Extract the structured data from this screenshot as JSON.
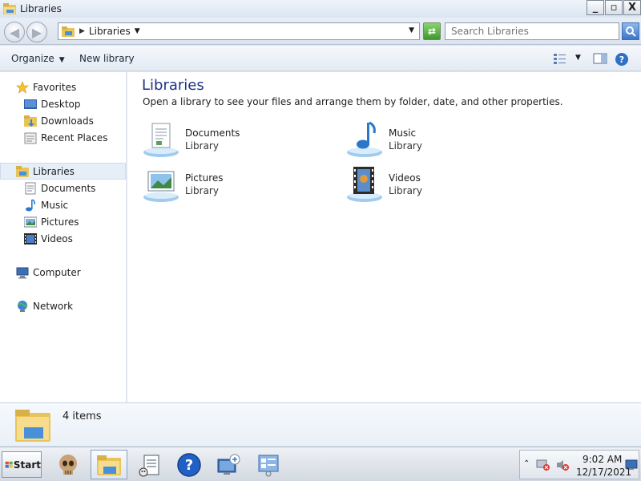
{
  "window": {
    "title": "Libraries",
    "buttons": {
      "minimize": "_",
      "maximize": "▫",
      "close": "X"
    }
  },
  "address_bar": {
    "separator": "▶",
    "crumb": "Libraries",
    "crumb_dropdown": "▼",
    "dropdown": "▼"
  },
  "search": {
    "placeholder": "Search Libraries"
  },
  "command_bar": {
    "organize": "Organize",
    "organize_dropdown": "▼",
    "new_library": "New library"
  },
  "nav_pane": {
    "favorites": {
      "label": "Favorites",
      "icon": "star-icon",
      "items": [
        {
          "label": "Desktop",
          "icon": "desktop-icon"
        },
        {
          "label": "Downloads",
          "icon": "downloads-folder-icon"
        },
        {
          "label": "Recent Places",
          "icon": "recent-places-icon"
        }
      ]
    },
    "libraries": {
      "label": "Libraries",
      "icon": "libraries-icon",
      "items": [
        {
          "label": "Documents",
          "icon": "document-icon"
        },
        {
          "label": "Music",
          "icon": "music-note-icon"
        },
        {
          "label": "Pictures",
          "icon": "picture-icon"
        },
        {
          "label": "Videos",
          "icon": "video-icon"
        }
      ]
    },
    "computer": {
      "label": "Computer",
      "icon": "computer-icon"
    },
    "network": {
      "label": "Network",
      "icon": "network-icon"
    }
  },
  "content": {
    "heading": "Libraries",
    "subtitle": "Open a library to see your files and arrange them by folder, date, and other properties.",
    "libraries": [
      {
        "name": "Documents",
        "type": "Library",
        "icon": "documents-library-icon"
      },
      {
        "name": "Music",
        "type": "Library",
        "icon": "music-library-icon"
      },
      {
        "name": "Pictures",
        "type": "Library",
        "icon": "pictures-library-icon"
      },
      {
        "name": "Videos",
        "type": "Library",
        "icon": "videos-library-icon"
      }
    ]
  },
  "details_pane": {
    "count": "4 items"
  },
  "taskbar": {
    "start_label": "Start",
    "buttons": [
      "skull-icon",
      "explorer-icon",
      "notepad-icon",
      "help-icon",
      "remote-desktop-icon",
      "control-panel-icon"
    ],
    "clock": {
      "time": "9:02 AM",
      "date": "12/17/2021"
    }
  },
  "colors": {
    "heading": "#1e3287",
    "title_bar": "#dbe5f1",
    "nav_selected": "#e6eef8",
    "refresh_green": "#3c9a2b",
    "search_button_blue": "#3a75c8"
  }
}
